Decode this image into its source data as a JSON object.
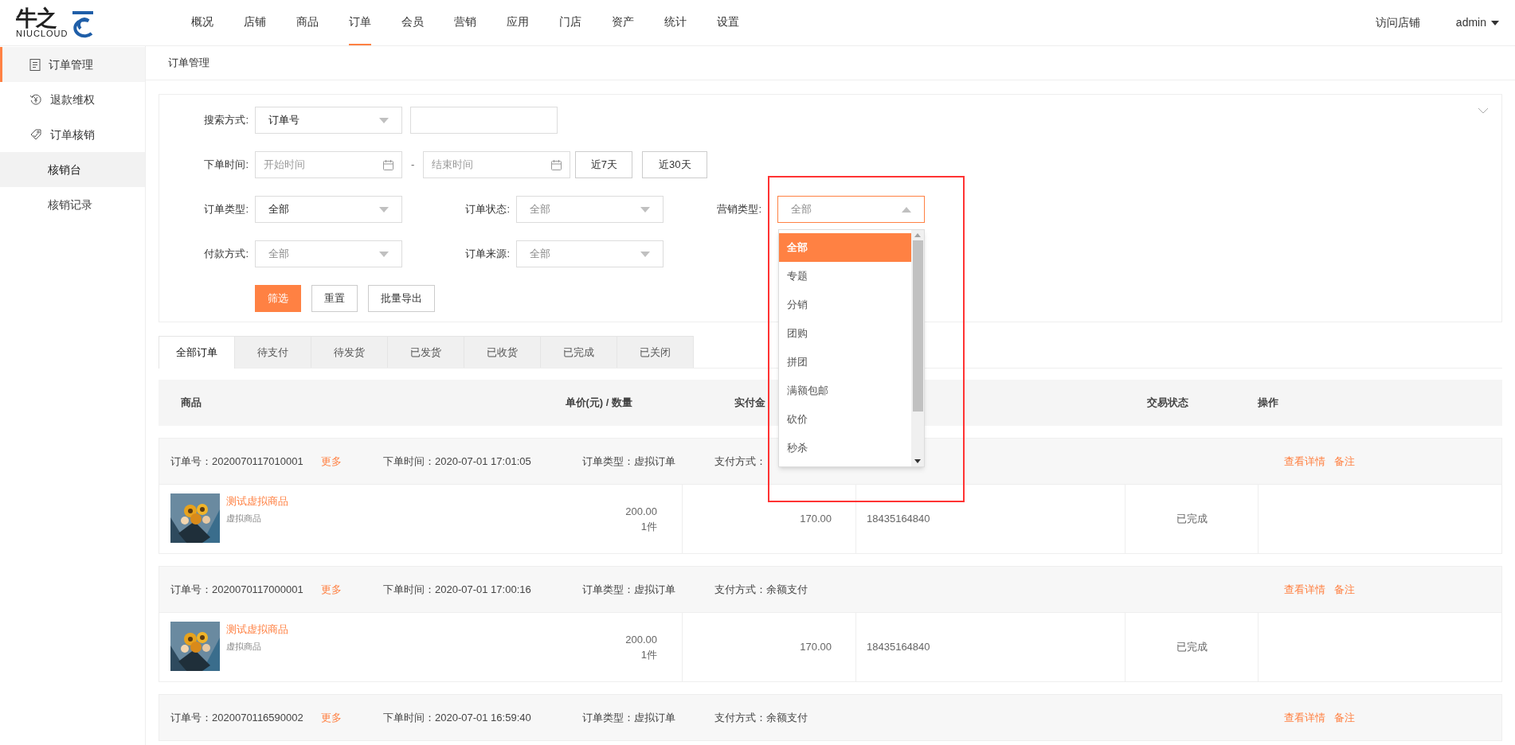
{
  "logo": {
    "mark": "牛之",
    "wordmark": "NIUCLOUD"
  },
  "nav": [
    {
      "label": "概况",
      "selected": false
    },
    {
      "label": "店铺",
      "selected": false
    },
    {
      "label": "商品",
      "selected": false
    },
    {
      "label": "订单",
      "selected": true
    },
    {
      "label": "会员",
      "selected": false
    },
    {
      "label": "营销",
      "selected": false
    },
    {
      "label": "应用",
      "selected": false
    },
    {
      "label": "门店",
      "selected": false
    },
    {
      "label": "资产",
      "selected": false
    },
    {
      "label": "统计",
      "selected": false
    },
    {
      "label": "设置",
      "selected": false
    }
  ],
  "top_right": {
    "visit_store": "访问店铺",
    "user": "admin"
  },
  "sidebar": {
    "items": [
      {
        "label": "订单管理",
        "selected": true
      },
      {
        "label": "退款维权",
        "selected": false
      },
      {
        "label": "订单核销",
        "selected": false,
        "children": [
          {
            "label": "核销台",
            "selected": true
          },
          {
            "label": "核销记录",
            "selected": false
          }
        ]
      }
    ]
  },
  "breadcrumb": "订单管理",
  "filters": {
    "search": {
      "label": "搜索方式:",
      "value": "订单号"
    },
    "date": {
      "label": "下单时间:",
      "start_placeholder": "开始时间",
      "separator": "-",
      "end_placeholder": "结束时间",
      "quick": [
        "近7天",
        "近30天"
      ]
    },
    "selects": [
      [
        {
          "label": "订单类型:",
          "value": "全部",
          "dim": false,
          "open": false
        },
        {
          "label": "订单状态:",
          "value": "全部",
          "dim": true,
          "open": false
        },
        {
          "label": "营销类型:",
          "value": "全部",
          "dim": true,
          "open": true,
          "options": [
            {
              "label": "全部",
              "selected": true
            },
            {
              "label": "专题",
              "selected": false
            },
            {
              "label": "分销",
              "selected": false
            },
            {
              "label": "团购",
              "selected": false
            },
            {
              "label": "拼团",
              "selected": false
            },
            {
              "label": "满额包邮",
              "selected": false
            },
            {
              "label": "砍价",
              "selected": false
            },
            {
              "label": "秒杀",
              "selected": false
            }
          ]
        }
      ],
      [
        {
          "label": "付款方式:",
          "value": "全部",
          "dim": true,
          "open": false
        },
        {
          "label": "订单来源:",
          "value": "全部",
          "dim": true,
          "open": false
        }
      ]
    ],
    "buttons": [
      {
        "label": "筛选",
        "kind": "primary"
      },
      {
        "label": "重置",
        "kind": "default"
      },
      {
        "label": "批量导出",
        "kind": "default"
      }
    ]
  },
  "tabs": [
    {
      "label": "全部订单",
      "selected": true
    },
    {
      "label": "待支付",
      "selected": false
    },
    {
      "label": "待发货",
      "selected": false
    },
    {
      "label": "已发货",
      "selected": false
    },
    {
      "label": "已收货",
      "selected": false
    },
    {
      "label": "已完成",
      "selected": false
    },
    {
      "label": "已关闭",
      "selected": false
    }
  ],
  "table": {
    "columns": [
      "商品",
      "单价(元) / 数量",
      "实付金",
      "交易状态",
      "操作"
    ],
    "orders": [
      {
        "no_label": "订单号：",
        "no": "2020070117010001",
        "more": "更多",
        "time_label": "下单时间：",
        "time": "2020-07-01 17:01:05",
        "type_label": "订单类型：",
        "type": "虚拟订单",
        "pay_label": "支付方式：",
        "actions": [
          "查看详情",
          "备注"
        ],
        "item": {
          "name": "测试虚拟商品",
          "subtitle": "虚拟商品",
          "price": "200.00",
          "qty": "1件",
          "amount": "170.00",
          "buyer": "18435164840",
          "status": "已完成"
        }
      },
      {
        "no_label": "订单号：",
        "no": "2020070117000001",
        "more": "更多",
        "time_label": "下单时间：",
        "time": "2020-07-01 17:00:16",
        "type_label": "订单类型：",
        "type": "虚拟订单",
        "pay_label": "支付方式：",
        "pay": "余额支付",
        "actions": [
          "查看详情",
          "备注"
        ],
        "item": {
          "name": "测试虚拟商品",
          "subtitle": "虚拟商品",
          "price": "200.00",
          "qty": "1件",
          "amount": "170.00",
          "buyer": "18435164840",
          "status": "已完成"
        }
      },
      {
        "no_label": "订单号：",
        "no": "2020070116590002",
        "more": "更多",
        "time_label": "下单时间：",
        "time": "2020-07-01 16:59:40",
        "type_label": "订单类型：",
        "type": "虚拟订单",
        "pay_label": "支付方式：",
        "pay": "余额支付",
        "actions": [
          "查看详情",
          "备注"
        ]
      }
    ]
  }
}
